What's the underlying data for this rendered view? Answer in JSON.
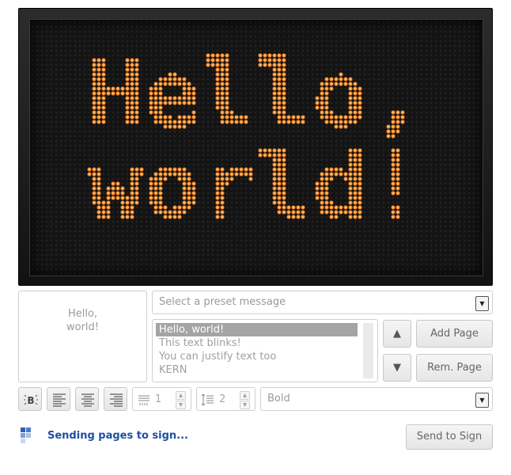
{
  "sign": {
    "lines": [
      "Hello,",
      "world!"
    ],
    "led_color": "#ff9a3c",
    "led_glow": "#d46a10"
  },
  "preview": {
    "lines": [
      "Hello,",
      "world!"
    ]
  },
  "preset": {
    "placeholder": "Select a preset message"
  },
  "pages": [
    {
      "label": "Hello, world!",
      "selected": true
    },
    {
      "label": "This text blinks!",
      "selected": false
    },
    {
      "label": "You can justify text too",
      "selected": false
    },
    {
      "label": "KERN",
      "selected": false
    }
  ],
  "buttons": {
    "up": "▲",
    "down": "▼",
    "add_page": "Add Page",
    "rem_page": "Rem. Page",
    "send": "Send to Sign"
  },
  "toolbar": {
    "blink_icon": "blink-icon",
    "align_left_icon": "align-left-icon",
    "align_center_icon": "align-center-icon",
    "align_right_icon": "align-right-icon",
    "char_spacing": "1",
    "line_spacing": "2",
    "font": "Bold"
  },
  "status": {
    "text": "Sending pages to sign...",
    "color": "#1f4fa3"
  }
}
